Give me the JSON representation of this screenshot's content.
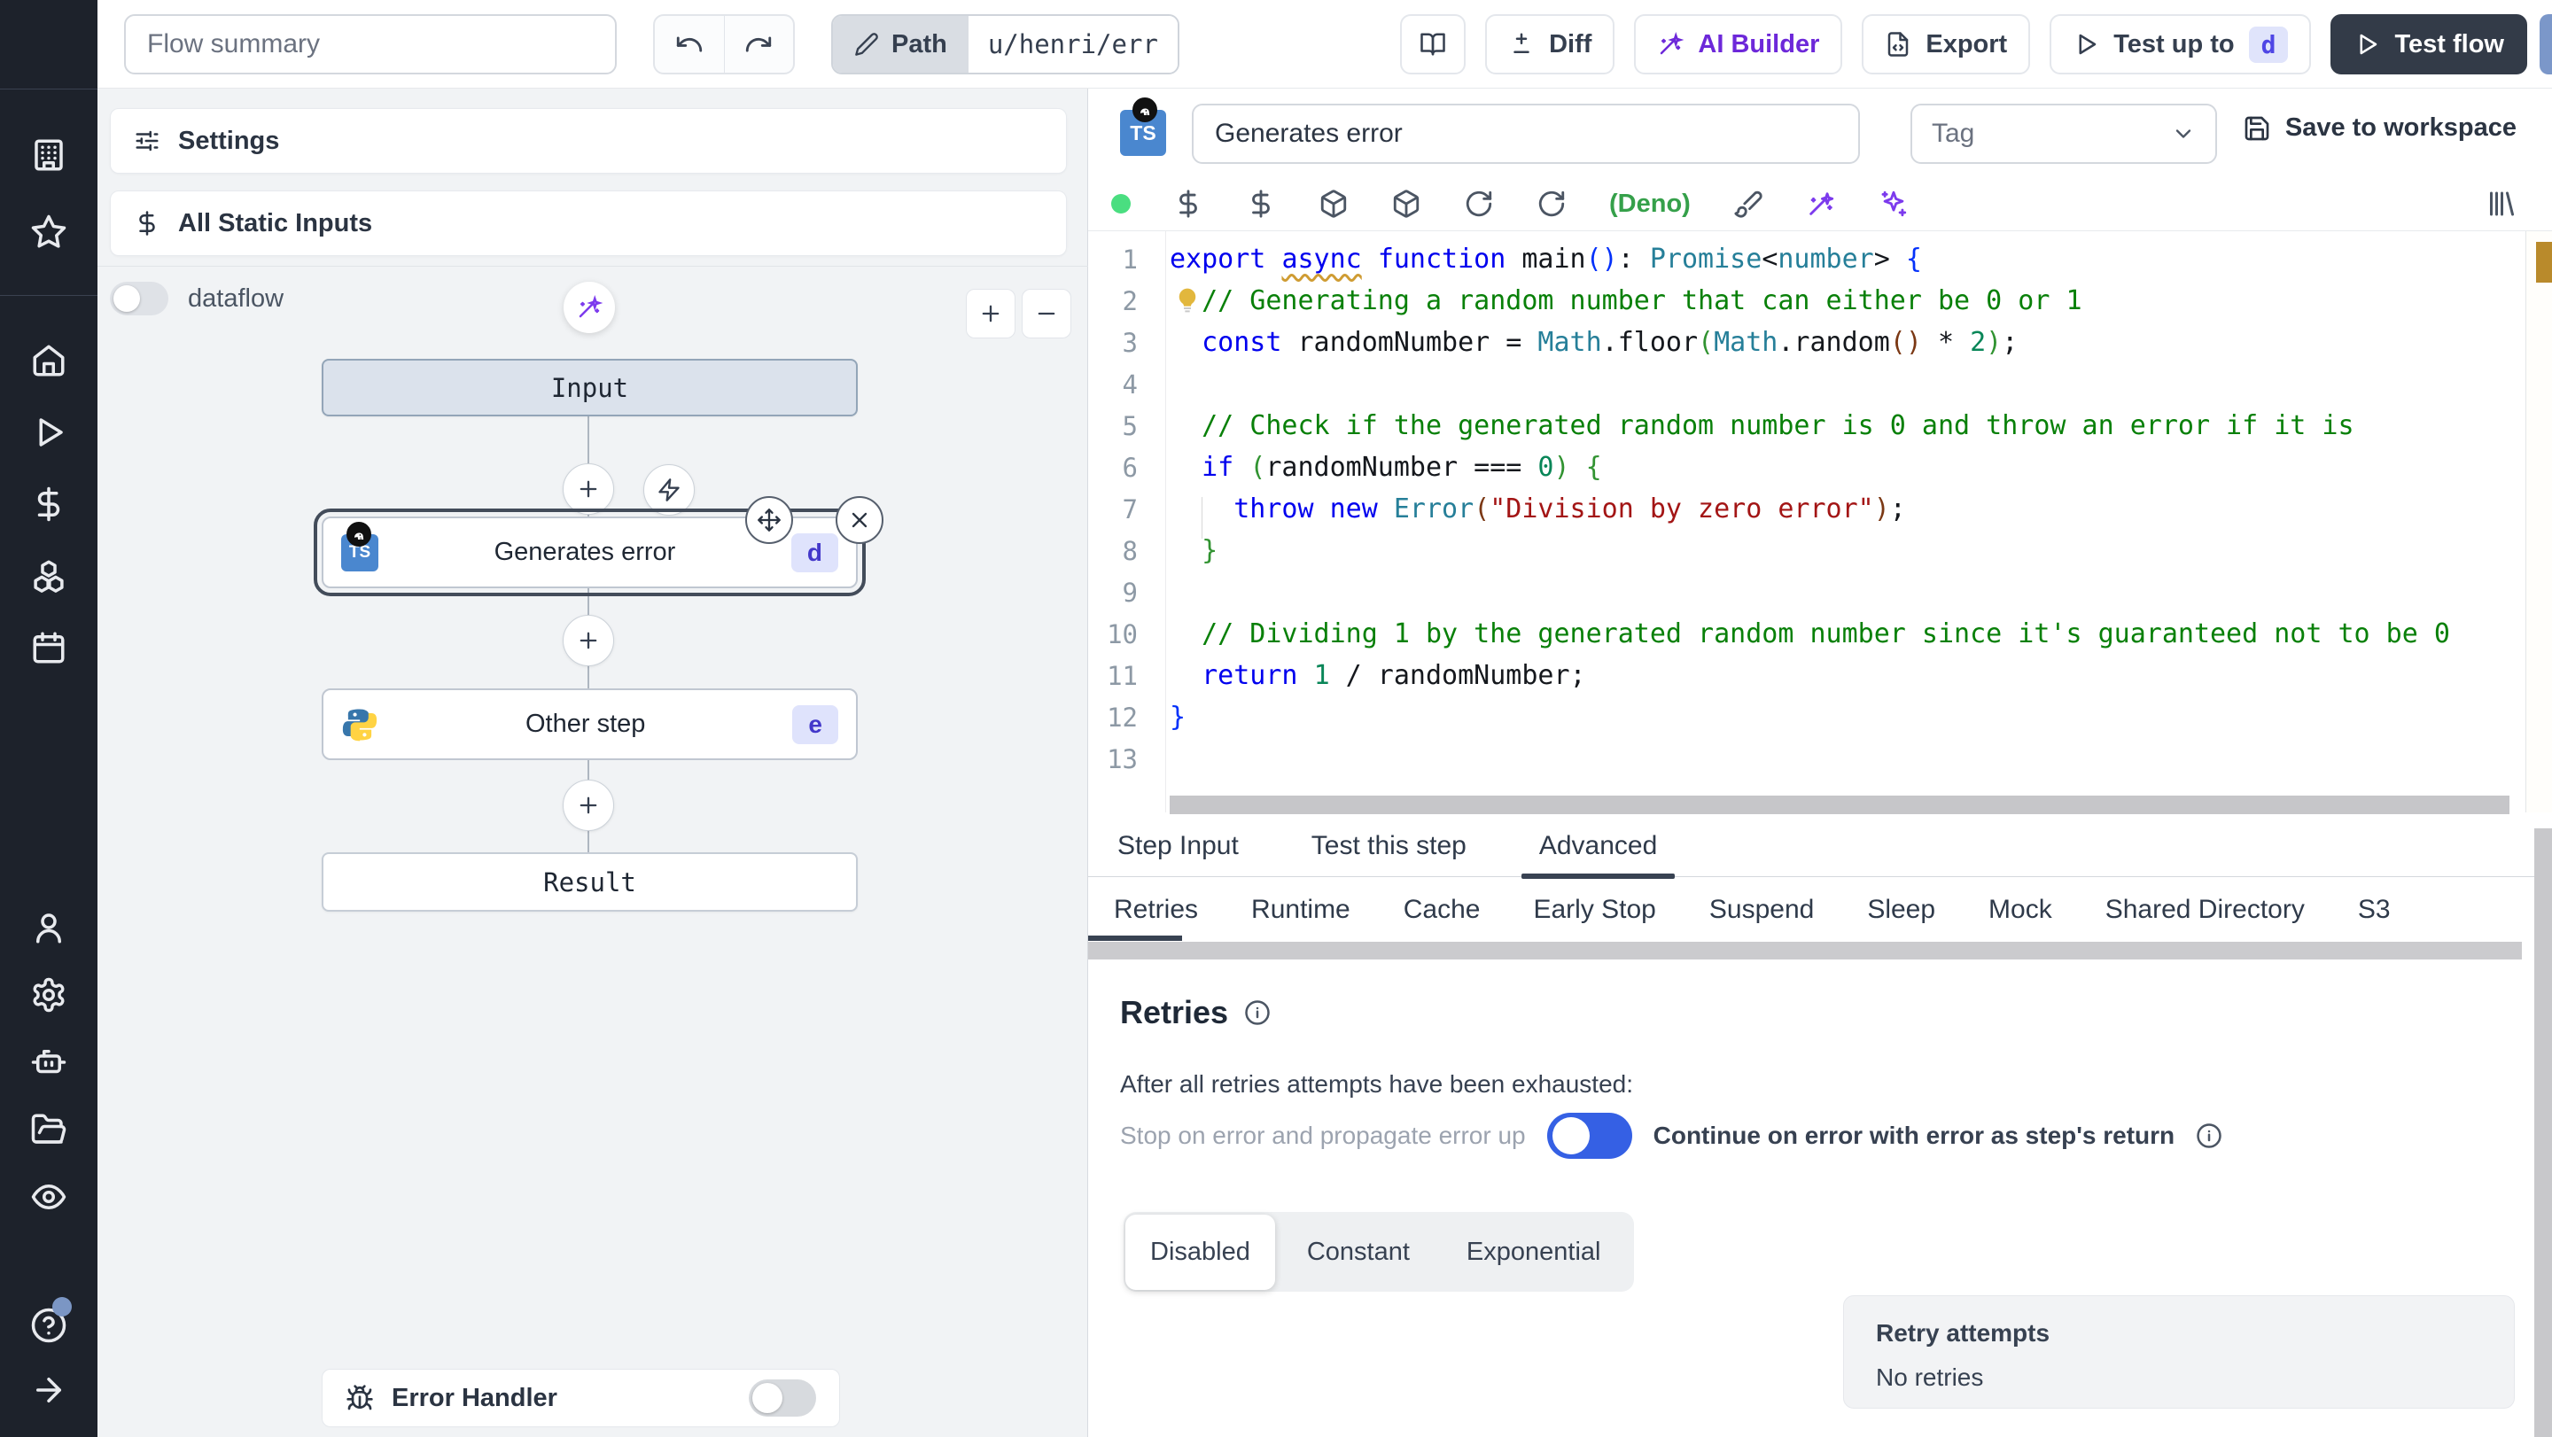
{
  "colors": {
    "sidebar_bg": "#1d222b",
    "accent_toggle_on": "#3560e4",
    "badge_bg": "#dfe3fc",
    "badge_text": "#4338ca",
    "ai_purple": "#6d28d9",
    "status_green": "#4ade80",
    "deno_green": "#35a04a",
    "test_flow_bg": "#333b48",
    "selection_ring": "#434c5a"
  },
  "sidebar": {
    "items_top": [
      {
        "icon": "building"
      },
      {
        "icon": "star"
      }
    ],
    "items_main": [
      {
        "icon": "home"
      },
      {
        "icon": "play"
      },
      {
        "icon": "dollar"
      },
      {
        "icon": "cubes"
      },
      {
        "icon": "calendar"
      }
    ],
    "items_lower": [
      {
        "icon": "user"
      },
      {
        "icon": "gear"
      },
      {
        "icon": "robot"
      },
      {
        "icon": "folder"
      },
      {
        "icon": "eye"
      }
    ],
    "items_bottom": [
      {
        "icon": "help",
        "badge": true
      },
      {
        "icon": "arrow-right"
      }
    ]
  },
  "topbar": {
    "flow_summary_placeholder": "Flow summary",
    "path_label": "Path",
    "path_value": "u/henri/err",
    "diff_label": "Diff",
    "ai_builder_label": "AI Builder",
    "export_label": "Export",
    "test_up_to_label": "Test up to",
    "test_up_to_badge": "d",
    "test_flow_label": "Test flow"
  },
  "flow_panel": {
    "settings_label": "Settings",
    "static_inputs_label": "All Static Inputs",
    "dataflow_label": "dataflow",
    "error_handler_label": "Error Handler",
    "graph": {
      "input_label": "Input",
      "result_label": "Result",
      "step1_label": "Generates error",
      "step1_badge": "d",
      "step2_label": "Other step",
      "step2_badge": "e"
    }
  },
  "step_editor": {
    "name_value": "Generates error",
    "tag_placeholder": "Tag",
    "save_label": "Save to workspace",
    "runtime_label": "(Deno)",
    "toolbar_icons_left": [
      "dollar",
      "dollar",
      "package",
      "package",
      "rotate",
      "rotate"
    ],
    "toolbar_icons_right": [
      "brush",
      "wand",
      "sparkles"
    ],
    "corner_icon": "library",
    "tabs": [
      {
        "label": "Step Input",
        "active": false
      },
      {
        "label": "Test this step",
        "active": false
      },
      {
        "label": "Advanced",
        "active": true
      }
    ],
    "subtabs": [
      {
        "label": "Retries",
        "active": true
      },
      {
        "label": "Runtime",
        "active": false
      },
      {
        "label": "Cache",
        "active": false
      },
      {
        "label": "Early Stop",
        "active": false
      },
      {
        "label": "Suspend",
        "active": false
      },
      {
        "label": "Sleep",
        "active": false
      },
      {
        "label": "Mock",
        "active": false
      },
      {
        "label": "Shared Directory",
        "active": false
      },
      {
        "label": "S3",
        "active": false
      }
    ]
  },
  "code": {
    "language": "typescript",
    "lines": [
      {
        "n": 1,
        "tokens": [
          [
            "k",
            "export "
          ],
          [
            "ku",
            "async"
          ],
          [
            "pl",
            " "
          ],
          [
            "k",
            "function "
          ],
          [
            "pl",
            "main"
          ],
          [
            "b1",
            "()"
          ],
          [
            "pl",
            ": "
          ],
          [
            "t",
            "Promise"
          ],
          [
            "pl",
            "<"
          ],
          [
            "t",
            "number"
          ],
          [
            "pl",
            "> "
          ],
          [
            "b1",
            "{"
          ]
        ]
      },
      {
        "n": 2,
        "bulb": true,
        "tokens": [
          [
            "c",
            "  // Generating a random number that can either be 0 or 1"
          ]
        ]
      },
      {
        "n": 3,
        "tokens": [
          [
            "pl",
            "  "
          ],
          [
            "k",
            "const"
          ],
          [
            "pl",
            " randomNumber = "
          ],
          [
            "t",
            "Math"
          ],
          [
            "pl",
            ".floor"
          ],
          [
            "b2",
            "("
          ],
          [
            "t",
            "Math"
          ],
          [
            "pl",
            ".random"
          ],
          [
            "b3",
            "()"
          ],
          [
            "pl",
            " * "
          ],
          [
            "n",
            "2"
          ],
          [
            "b2",
            ")"
          ],
          [
            "pl",
            ";"
          ]
        ]
      },
      {
        "n": 4,
        "tokens": []
      },
      {
        "n": 5,
        "tokens": [
          [
            "c",
            "  // Check if the generated random number is 0 and throw an error if it is"
          ]
        ]
      },
      {
        "n": 6,
        "tokens": [
          [
            "pl",
            "  "
          ],
          [
            "k",
            "if"
          ],
          [
            "pl",
            " "
          ],
          [
            "b2",
            "("
          ],
          [
            "pl",
            "randomNumber === "
          ],
          [
            "n",
            "0"
          ],
          [
            "b2",
            ")"
          ],
          [
            "pl",
            " "
          ],
          [
            "b2",
            "{"
          ]
        ]
      },
      {
        "n": 7,
        "tokens": [
          [
            "pl",
            "    "
          ],
          [
            "k",
            "throw"
          ],
          [
            "pl",
            " "
          ],
          [
            "k",
            "new"
          ],
          [
            "pl",
            " "
          ],
          [
            "t",
            "Error"
          ],
          [
            "b3",
            "("
          ],
          [
            "s",
            "\"Division by zero error\""
          ],
          [
            "b3",
            ")"
          ],
          [
            "pl",
            ";"
          ]
        ]
      },
      {
        "n": 8,
        "tokens": [
          [
            "pl",
            "  "
          ],
          [
            "b2",
            "}"
          ]
        ]
      },
      {
        "n": 9,
        "tokens": []
      },
      {
        "n": 10,
        "tokens": [
          [
            "c",
            "  // Dividing 1 by the generated random number since it's guaranteed not to be 0"
          ]
        ]
      },
      {
        "n": 11,
        "tokens": [
          [
            "pl",
            "  "
          ],
          [
            "k",
            "return"
          ],
          [
            "pl",
            " "
          ],
          [
            "n",
            "1"
          ],
          [
            "pl",
            " / randomNumber;"
          ]
        ]
      },
      {
        "n": 12,
        "tokens": [
          [
            "b1",
            "}"
          ]
        ]
      },
      {
        "n": 13,
        "tokens": []
      }
    ]
  },
  "retries": {
    "title": "Retries",
    "exhausted_label": "After all retries attempts have been exhausted:",
    "stop_label": "Stop on error and propagate error up",
    "continue_label": "Continue on error with error as step's return",
    "toggle_on": true,
    "strategies": [
      {
        "label": "Disabled",
        "active": true
      },
      {
        "label": "Constant",
        "active": false
      },
      {
        "label": "Exponential",
        "active": false
      }
    ],
    "retry_attempts_title": "Retry attempts",
    "retry_attempts_value": "No retries"
  }
}
